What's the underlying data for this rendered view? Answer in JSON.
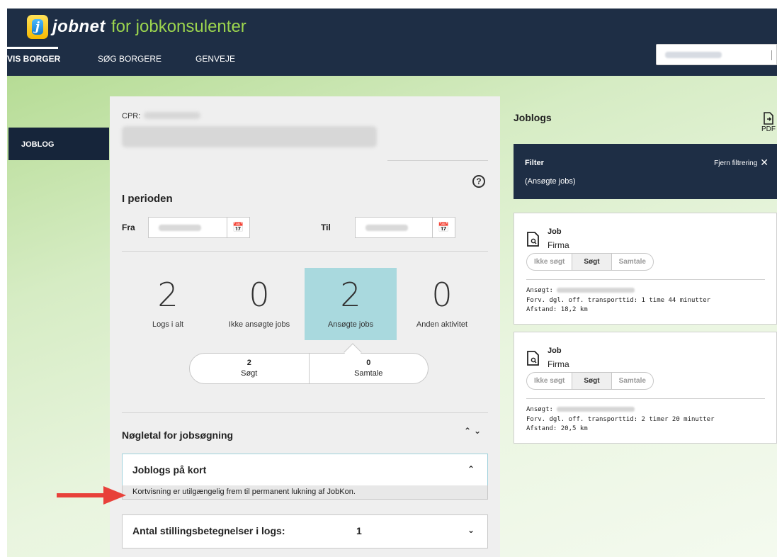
{
  "header": {
    "logo_letter": "j",
    "logo_word": "jobnet",
    "logo_sub": "for jobkonsulenter",
    "nav": [
      "VIS BORGER",
      "SØG BORGERE",
      "GENVEJE"
    ]
  },
  "sidebar": {
    "items": [
      {
        "label": "JOBLOG"
      }
    ]
  },
  "citizen": {
    "cpr_label": "CPR:"
  },
  "period": {
    "title": "I perioden",
    "from_label": "Fra",
    "to_label": "Til",
    "help": "?"
  },
  "stats": [
    {
      "value": "2",
      "label": "Logs i alt"
    },
    {
      "value": "0",
      "label": "Ikke ansøgte jobs"
    },
    {
      "value": "2",
      "label": "Ansøgte jobs"
    },
    {
      "value": "0",
      "label": "Anden aktivitet"
    }
  ],
  "breakdown": [
    {
      "value": "2",
      "label": "Søgt"
    },
    {
      "value": "0",
      "label": "Samtale"
    }
  ],
  "keyfigures": {
    "title": "Nøgletal for jobsøgning",
    "map_title": "Joblogs på kort",
    "map_message": "Kortvisning er utilgængelig frem til permanent lukning af JobKon.",
    "titles_label": "Antal stillingsbetegnelser i logs:",
    "titles_count": "1"
  },
  "joblogs": {
    "title": "Joblogs",
    "pdf_label": "PDF",
    "filter_title": "Filter",
    "filter_value": "(Ansøgte jobs)",
    "filter_remove": "Fjern filtrering",
    "status_options": [
      "Ikke søgt",
      "Søgt",
      "Samtale"
    ],
    "selected_status": "Søgt",
    "jobs": [
      {
        "title": "Job",
        "firm": "Firma",
        "applied_label": "Ansøgt:",
        "transport": "Forv. dgl. off. transporttid: 1 time 44 minutter",
        "distance": "Afstand: 18,2 km"
      },
      {
        "title": "Job",
        "firm": "Firma",
        "applied_label": "Ansøgt:",
        "transport": "Forv. dgl. off. transporttid: 2 timer 20 minutter",
        "distance": "Afstand: 20,5 km"
      }
    ]
  },
  "colors": {
    "header_bg": "#1e2e45",
    "logo_sub": "#9cd54e",
    "active_stat": "#a9d9de",
    "arrow": "#e8413a"
  }
}
